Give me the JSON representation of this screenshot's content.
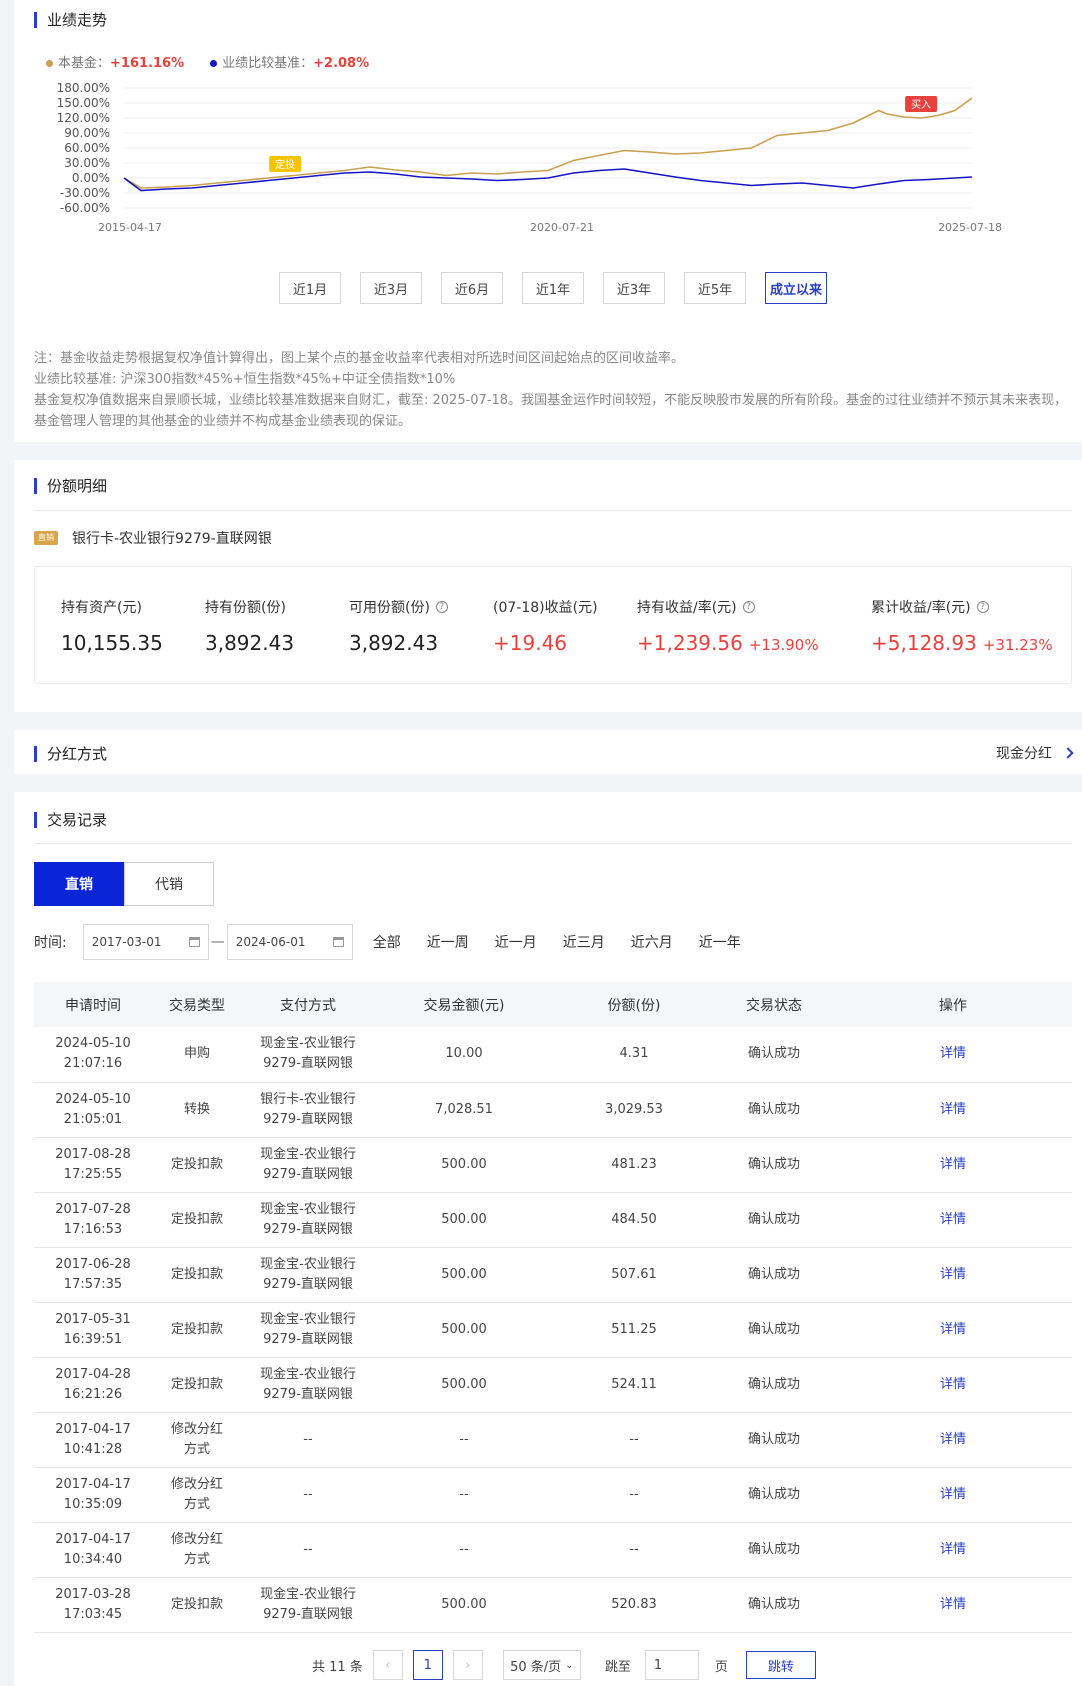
{
  "performance": {
    "title": "业绩走势",
    "legend": [
      {
        "label": "本基金：",
        "value": "+161.16%",
        "color": "#c9a04f"
      },
      {
        "label": "业绩比较基准：",
        "value": "+2.08%",
        "color": "#1515c4"
      }
    ],
    "ranges": [
      "近1月",
      "近3月",
      "近6月",
      "近1年",
      "近3年",
      "近5年",
      "成立以来"
    ],
    "active_range": "成立以来",
    "notes": [
      "注：基金收益走势根据复权净值计算得出，图上某个点的基金收益率代表相对所选时间区间起始点的区间收益率。",
      "业绩比较基准: 沪深300指数*45%+恒生指数*45%+中证全债指数*10%",
      "基金复权净值数据来自景顺长城，业绩比较基准数据来自财汇，截至: 2025-07-18。我国基金运作时间较短，不能反映股市发展的所有阶段。基金的过往业绩并不预示其未来表现，基金管理人管理的其他基金的业绩并不构成基金业绩表现的保证。"
    ]
  },
  "chart_data": {
    "type": "line",
    "y_ticks": [
      "180.00%",
      "150.00%",
      "120.00%",
      "90.00%",
      "60.00%",
      "30.00%",
      "0.00%",
      "-30.00%",
      "-60.00%"
    ],
    "ylim": [
      -60,
      180
    ],
    "x_ticks": [
      "2015-04-17",
      "2020-07-21",
      "2025-07-18"
    ],
    "annotations": [
      {
        "label": "定投",
        "x": 0.19,
        "color": "#f5c400"
      },
      {
        "label": "买入",
        "x": 0.94,
        "color": "#e8413d"
      }
    ],
    "series": [
      {
        "color": "#c9a04f",
        "x": [
          0,
          0.02,
          0.05,
          0.08,
          0.11,
          0.14,
          0.17,
          0.2,
          0.23,
          0.26,
          0.29,
          0.32,
          0.35,
          0.38,
          0.41,
          0.44,
          0.47,
          0.5,
          0.53,
          0.56,
          0.59,
          0.62,
          0.65,
          0.68,
          0.71,
          0.74,
          0.77,
          0.8,
          0.83,
          0.86,
          0.89,
          0.9,
          0.92,
          0.94,
          0.96,
          0.98,
          1.0
        ],
        "values": [
          0,
          -20,
          -18,
          -15,
          -10,
          -5,
          0,
          5,
          10,
          15,
          22,
          16,
          12,
          5,
          10,
          8,
          12,
          15,
          35,
          45,
          55,
          52,
          48,
          50,
          55,
          60,
          85,
          90,
          95,
          110,
          135,
          128,
          122,
          120,
          125,
          135,
          160
        ]
      },
      {
        "color": "#1515c4",
        "x": [
          0,
          0.02,
          0.05,
          0.08,
          0.11,
          0.14,
          0.17,
          0.2,
          0.23,
          0.26,
          0.29,
          0.32,
          0.35,
          0.38,
          0.41,
          0.44,
          0.47,
          0.5,
          0.53,
          0.56,
          0.59,
          0.62,
          0.65,
          0.68,
          0.71,
          0.74,
          0.77,
          0.8,
          0.83,
          0.86,
          0.89,
          0.92,
          0.95,
          0.98,
          1.0
        ],
        "values": [
          0,
          -25,
          -22,
          -20,
          -15,
          -10,
          -5,
          0,
          5,
          10,
          12,
          8,
          2,
          0,
          -2,
          -5,
          -3,
          0,
          10,
          15,
          18,
          10,
          2,
          -5,
          -10,
          -15,
          -12,
          -10,
          -15,
          -20,
          -12,
          -5,
          -3,
          0,
          2
        ]
      }
    ]
  },
  "shares": {
    "title": "份额明细",
    "bank": "银行卡-农业银行9279-直联网银",
    "bank_tag": "直销",
    "stats": [
      {
        "label": "持有资产(元)",
        "value": "10,155.35",
        "help": false
      },
      {
        "label": "持有份额(份)",
        "value": "3,892.43",
        "help": false
      },
      {
        "label": "可用份额(份)",
        "value": "3,892.43",
        "help": true
      },
      {
        "label": "(07-18)收益(元)",
        "value": "+19.46",
        "help": false
      },
      {
        "label": "持有收益/率(元)",
        "value": "+1,239.56",
        "rate": "+13.90%",
        "help": true
      },
      {
        "label": "累计收益/率(元)",
        "value": "+5,128.93",
        "rate": "+31.23%",
        "help": true
      }
    ]
  },
  "dividend": {
    "title": "分红方式",
    "value": "现金分红"
  },
  "transactions": {
    "title": "交易记录",
    "tabs": [
      "直销",
      "代销"
    ],
    "filter_label": "时间:",
    "date_from": "2017-03-01",
    "date_to": "2024-06-01",
    "date_sep": "—",
    "quick_ranges": [
      "全部",
      "近一周",
      "近一月",
      "近三月",
      "近六月",
      "近一年"
    ],
    "columns": [
      "申请时间",
      "交易类型",
      "支付方式",
      "交易金额(元)",
      "份额(份)",
      "交易状态",
      "操作"
    ],
    "rows": [
      [
        "2024-05-10\n21:07:16",
        "申购",
        "现金宝-农业银行\n9279-直联网银",
        "10.00",
        "4.31",
        "确认成功",
        "详情"
      ],
      [
        "2024-05-10\n21:05:01",
        "转换",
        "银行卡-农业银行\n9279-直联网银",
        "7,028.51",
        "3,029.53",
        "确认成功",
        "详情"
      ],
      [
        "2017-08-28\n17:25:55",
        "定投扣款",
        "现金宝-农业银行\n9279-直联网银",
        "500.00",
        "481.23",
        "确认成功",
        "详情"
      ],
      [
        "2017-07-28\n17:16:53",
        "定投扣款",
        "现金宝-农业银行\n9279-直联网银",
        "500.00",
        "484.50",
        "确认成功",
        "详情"
      ],
      [
        "2017-06-28\n17:57:35",
        "定投扣款",
        "现金宝-农业银行\n9279-直联网银",
        "500.00",
        "507.61",
        "确认成功",
        "详情"
      ],
      [
        "2017-05-31\n16:39:51",
        "定投扣款",
        "现金宝-农业银行\n9279-直联网银",
        "500.00",
        "511.25",
        "确认成功",
        "详情"
      ],
      [
        "2017-04-28\n16:21:26",
        "定投扣款",
        "现金宝-农业银行\n9279-直联网银",
        "500.00",
        "524.11",
        "确认成功",
        "详情"
      ],
      [
        "2017-04-17\n10:41:28",
        "修改分红\n方式",
        "--",
        "--",
        "--",
        "确认成功",
        "详情"
      ],
      [
        "2017-04-17\n10:35:09",
        "修改分红\n方式",
        "--",
        "--",
        "--",
        "确认成功",
        "详情"
      ],
      [
        "2017-04-17\n10:34:40",
        "修改分红\n方式",
        "--",
        "--",
        "--",
        "确认成功",
        "详情"
      ],
      [
        "2017-03-28\n17:03:45",
        "定投扣款",
        "现金宝-农业银行\n9279-直联网银",
        "500.00",
        "520.83",
        "确认成功",
        "详情"
      ]
    ],
    "pager": {
      "total": "共 11 条",
      "prev": "‹",
      "current": "1",
      "next": "›",
      "page_size": "50 条/页",
      "jump_label": "跳至",
      "jump_value": "1",
      "page_unit": "页",
      "go": "跳转"
    }
  }
}
